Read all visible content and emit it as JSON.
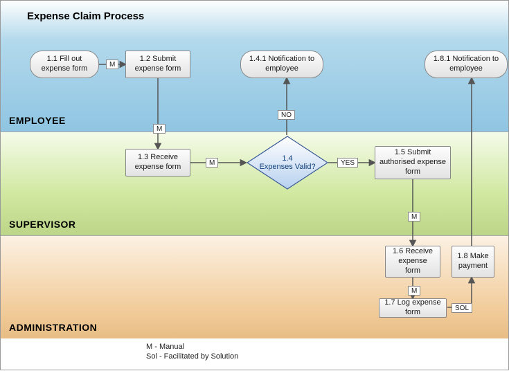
{
  "title": "Expense Claim Process",
  "lanes": {
    "employee": "EMPLOYEE",
    "supervisor": "SUPERVISOR",
    "admin": "ADMINISTRATION"
  },
  "nodes": {
    "n11": {
      "num": "1.1",
      "text": "Fill out expense form"
    },
    "n12": {
      "num": "1.2",
      "text": "Submit expense form"
    },
    "n141": {
      "num": "1.4.1",
      "text": "Notification to employee"
    },
    "n181": {
      "num": "1.8.1",
      "text": "Notification to employee"
    },
    "n13": {
      "num": "1.3",
      "text": "Receive expense form"
    },
    "n14": {
      "num": "1.4",
      "text": "Expenses  Valid?"
    },
    "n15": {
      "num": "1.5",
      "text": "Submit authorised expense form"
    },
    "n16": {
      "num": "1.6",
      "text": "Receive expense form"
    },
    "n17": {
      "num": "1.7",
      "text": "Log expense form"
    },
    "n18": {
      "num": "1.8",
      "text": "Make payment"
    }
  },
  "edge_labels": {
    "m1": "M",
    "m2": "M",
    "m3": "M",
    "m4": "M",
    "m5": "M",
    "no": "NO",
    "yes": "YES",
    "sol": "SOL"
  },
  "legend": {
    "m": "M - Manual",
    "sol": "Sol - Facilitated by Solution"
  }
}
